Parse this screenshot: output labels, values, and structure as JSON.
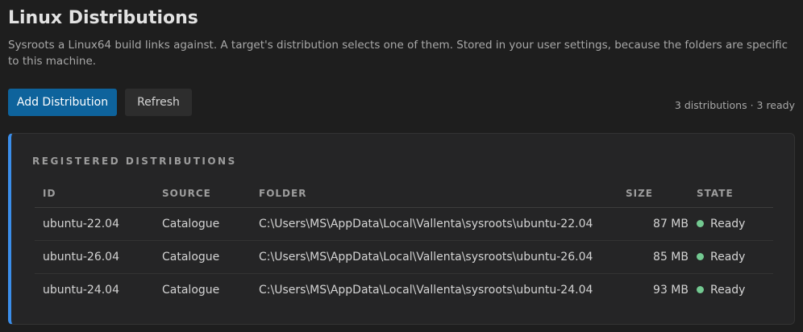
{
  "header": {
    "title": "Linux Distributions",
    "description": "Sysroots a Linux64 build links against. A target's distribution selects one of them. Stored in your user settings, because the folders are specific to this machine."
  },
  "toolbar": {
    "add_label": "Add Distribution",
    "refresh_label": "Refresh",
    "summary": "3 distributions · 3 ready"
  },
  "panel": {
    "section_label": "REGISTERED DISTRIBUTIONS",
    "columns": {
      "id": "ID",
      "source": "SOURCE",
      "folder": "FOLDER",
      "size": "SIZE",
      "state": "STATE"
    },
    "rows": [
      {
        "id": "ubuntu-22.04",
        "source": "Catalogue",
        "folder": "C:\\Users\\MS\\AppData\\Local\\Vallenta\\sysroots\\ubuntu-22.04",
        "size": "87 MB",
        "state": "Ready"
      },
      {
        "id": "ubuntu-26.04",
        "source": "Catalogue",
        "folder": "C:\\Users\\MS\\AppData\\Local\\Vallenta\\sysroots\\ubuntu-26.04",
        "size": "85 MB",
        "state": "Ready"
      },
      {
        "id": "ubuntu-24.04",
        "source": "Catalogue",
        "folder": "C:\\Users\\MS\\AppData\\Local\\Vallenta\\sysroots\\ubuntu-24.04",
        "size": "93 MB",
        "state": "Ready"
      }
    ]
  },
  "colors": {
    "accent": "#0e639c",
    "panel_edge": "#3b8eea",
    "status_ready": "#73c991"
  }
}
